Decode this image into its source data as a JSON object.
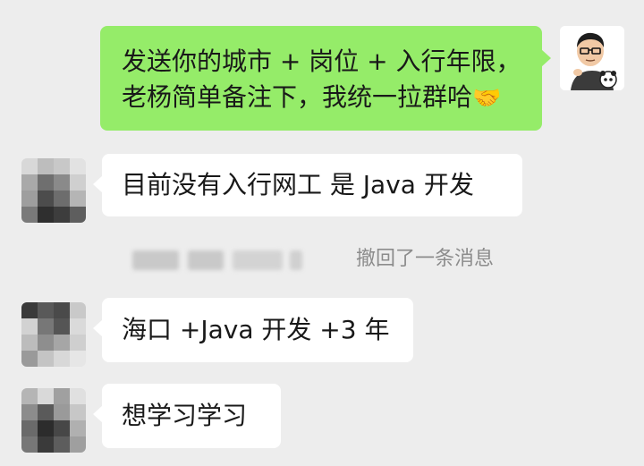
{
  "messages": [
    {
      "sender": "self",
      "line1": "发送你的城市 + 岗位 + 入行年限，",
      "line2": "老杨简单备注下，我统一拉群哈",
      "emoji": "🤝"
    },
    {
      "sender": "other",
      "text": "目前没有入行网工 是 Java 开发"
    },
    {
      "sender": "other",
      "text": "海口 +Java 开发 +3 年"
    },
    {
      "sender": "other",
      "text": "想学习学习"
    }
  ],
  "system_notice": {
    "text": "撤回了一条消息"
  },
  "colors": {
    "background": "#ededed",
    "self_bubble": "#95ec69",
    "other_bubble": "#ffffff",
    "notice_text": "#8c8c8c"
  },
  "icons": {
    "self_avatar": "cartoon-man-avatar-icon",
    "other_avatar": "pixelated-avatar-icon",
    "emoji": "handshake-icon"
  }
}
